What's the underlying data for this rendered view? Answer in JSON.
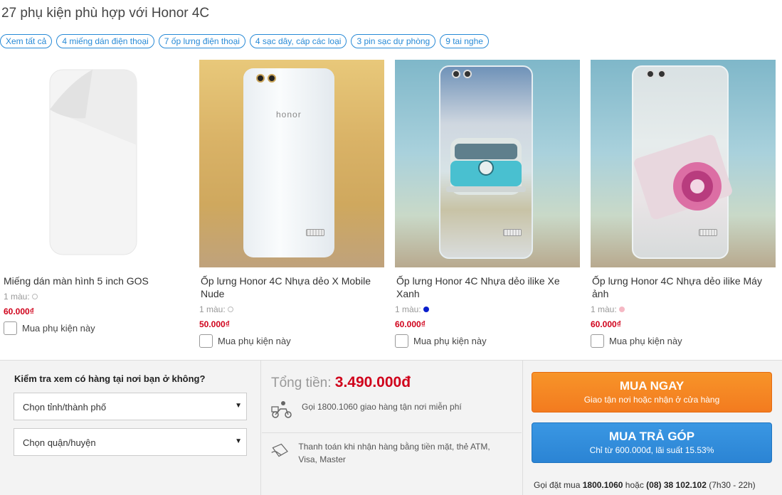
{
  "page": {
    "title": "27 phụ kiện phù hợp với Honor 4C"
  },
  "filters": [
    "Xem tất cả",
    "4 miếng dán điện thoại",
    "7 ốp lưng điện thoại",
    "4 sạc dây, cáp các loại",
    "3 pin sạc dự phòng",
    "9 tai nghe"
  ],
  "products": [
    {
      "name": "Miếng dán màn hình 5 inch GOS",
      "colors_label": "1 màu:",
      "color": "#ffffff",
      "price": "60.000₫",
      "buy_label": "Mua phụ kiện này"
    },
    {
      "name": "Ốp lưng Honor 4C Nhựa dẻo X Mobile Nude",
      "colors_label": "1 màu:",
      "color": "#ffffff",
      "price": "50.000₫",
      "buy_label": "Mua phụ kiện này",
      "brand": "honor"
    },
    {
      "name": "Ốp lưng Honor 4C Nhựa dẻo ilike Xe Xanh",
      "colors_label": "1 màu:",
      "color": "#0a1fcc",
      "price": "60.000₫",
      "buy_label": "Mua phụ kiện này"
    },
    {
      "name": "Ốp lưng Honor 4C Nhựa dẻo ilike Máy ảnh",
      "colors_label": "1 màu:",
      "color": "#f5b8c4",
      "price": "60.000₫",
      "buy_label": "Mua phụ kiện này"
    }
  ],
  "check": {
    "title": "Kiểm tra xem có hàng tại nơi bạn ở không?",
    "city_select": "Chọn tỉnh/thành phố",
    "district_select": "Chọn quận/huyện"
  },
  "totals": {
    "label": "Tổng tiền:",
    "amount": "3.490.000đ",
    "delivery_text": "Gọi 1800.1060 giao hàng tận nơi miễn phí",
    "payment_text": "Thanh toán khi nhận hàng bằng tiền mặt, thẻ ATM, Visa, Master"
  },
  "actions": {
    "buy_now": "MUA NGAY",
    "buy_now_sub": "Giao tận nơi hoặc nhận ở cửa hàng",
    "installment": "MUA TRẢ GÓP",
    "installment_sub": "Chỉ từ 600.000đ, lãi suất 15.53%",
    "hotline_prefix": "Gọi đặt mua",
    "hotline_1": "1800.1060",
    "hotline_mid": "hoặc",
    "hotline_2": "(08) 38 102.102",
    "hotline_hours": "(7h30 - 22h)"
  },
  "colors": {
    "accent": "#288ad6",
    "price": "#d0021b",
    "buy_now": "#f37b1f",
    "installment": "#2b84d4"
  }
}
